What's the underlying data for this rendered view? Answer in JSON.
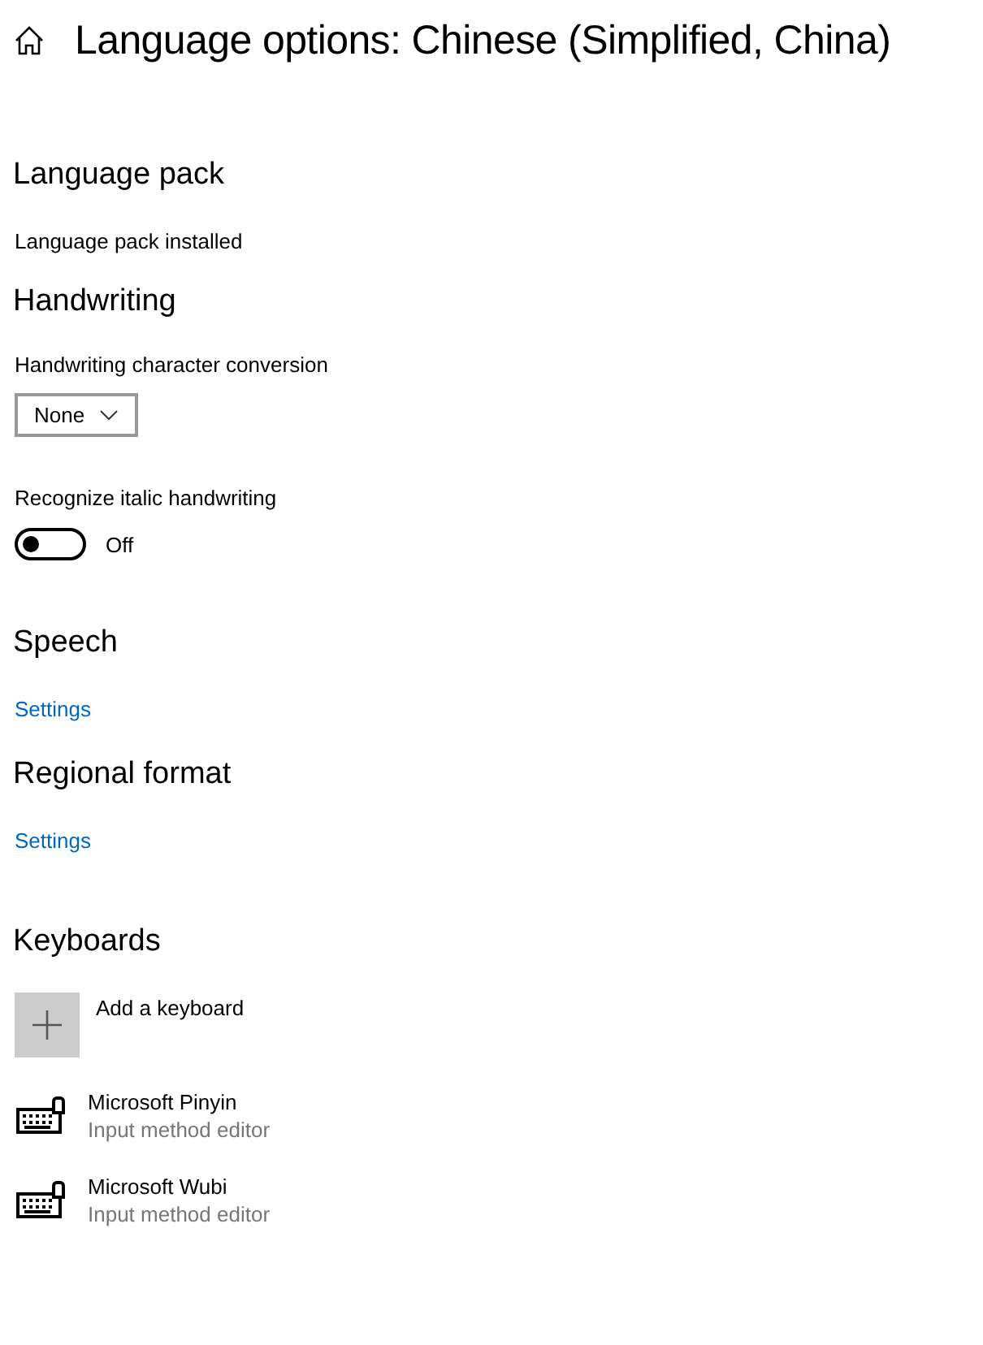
{
  "header": {
    "title": "Language options: Chinese (Simplified, China)"
  },
  "language_pack": {
    "heading": "Language pack",
    "status": "Language pack installed"
  },
  "handwriting": {
    "heading": "Handwriting",
    "conversion_label": "Handwriting character conversion",
    "conversion_value": "None",
    "italic_label": "Recognize italic handwriting",
    "italic_on": false,
    "italic_state": "Off"
  },
  "speech": {
    "heading": "Speech",
    "link": "Settings"
  },
  "regional_format": {
    "heading": "Regional format",
    "link": "Settings"
  },
  "keyboards": {
    "heading": "Keyboards",
    "add_label": "Add a keyboard",
    "items": [
      {
        "name": "Microsoft Pinyin",
        "type": "Input method editor"
      },
      {
        "name": "Microsoft Wubi",
        "type": "Input method editor"
      }
    ]
  }
}
